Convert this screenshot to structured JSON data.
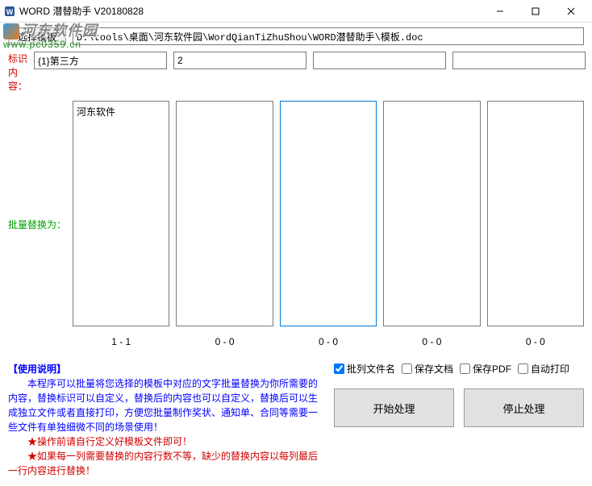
{
  "titlebar": {
    "title": "WORD 潜替助手 V20180828"
  },
  "watermark": {
    "line1": "河东软件园",
    "line2": "www.pc0359.cn"
  },
  "template": {
    "button_label": "选择模板",
    "path_value": "D:\\tools\\桌面\\河东软件园\\WordQianTiZhuShou\\WORD潜替助手\\模板.doc"
  },
  "ident": {
    "label": "标识内容：",
    "values": [
      "{1}第三方",
      "2",
      "",
      "",
      ""
    ]
  },
  "replace": {
    "label": "批量替换为：",
    "textarea_values": [
      "河东软件",
      "",
      "",
      "",
      ""
    ],
    "status": [
      "1 - 1",
      "0 - 0",
      "0 - 0",
      "0 - 0",
      "0 - 0"
    ]
  },
  "instructions": {
    "title": "【使用说明】",
    "line1": "　　本程序可以批量将您选择的模板中对应的文字批量替换为你所需要的内容，替换标识可以自定义，替换后的内容也可以自定义，替换后可以生成独立文件或者直接打印，方便您批量制作奖状、通知单、合同等需要一些文件有单独细微不同的场景使用！",
    "star1": "★操作前请自行定义好模板文件即可！",
    "star2": "★如果每一列需要替换的内容行数不等，缺少的替换内容以每列最后一行内容进行替换！"
  },
  "checkboxes": {
    "batch_filename": {
      "label": "批列文件名",
      "checked": true
    },
    "save_doc": {
      "label": "保存文档",
      "checked": false
    },
    "save_pdf": {
      "label": "保存PDF",
      "checked": false
    },
    "auto_print": {
      "label": "自动打印",
      "checked": false
    }
  },
  "actions": {
    "start": "开始处理",
    "stop": "停止处理"
  }
}
